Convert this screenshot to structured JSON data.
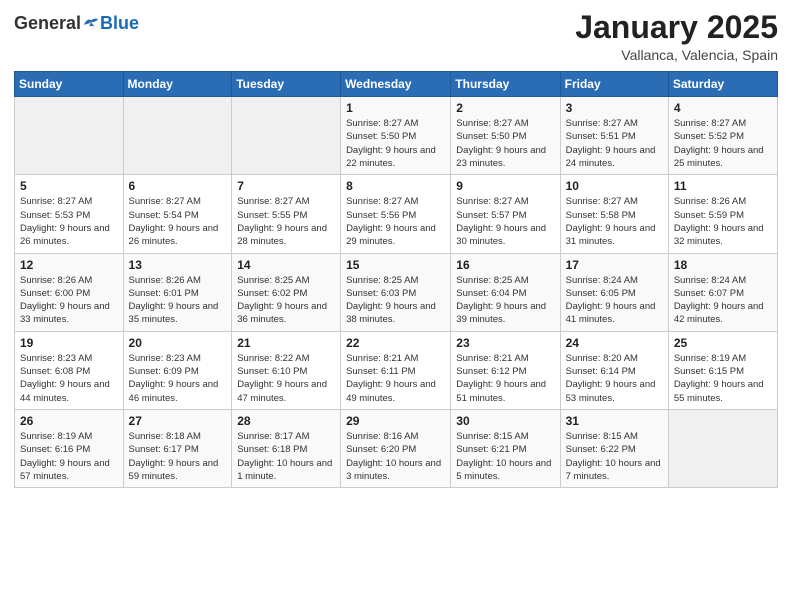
{
  "header": {
    "logo_general": "General",
    "logo_blue": "Blue",
    "month_title": "January 2025",
    "location": "Vallanca, Valencia, Spain"
  },
  "weekdays": [
    "Sunday",
    "Monday",
    "Tuesday",
    "Wednesday",
    "Thursday",
    "Friday",
    "Saturday"
  ],
  "weeks": [
    [
      {
        "day": "",
        "sunrise": "",
        "sunset": "",
        "daylight": ""
      },
      {
        "day": "",
        "sunrise": "",
        "sunset": "",
        "daylight": ""
      },
      {
        "day": "",
        "sunrise": "",
        "sunset": "",
        "daylight": ""
      },
      {
        "day": "1",
        "sunrise": "Sunrise: 8:27 AM",
        "sunset": "Sunset: 5:50 PM",
        "daylight": "Daylight: 9 hours and 22 minutes."
      },
      {
        "day": "2",
        "sunrise": "Sunrise: 8:27 AM",
        "sunset": "Sunset: 5:50 PM",
        "daylight": "Daylight: 9 hours and 23 minutes."
      },
      {
        "day": "3",
        "sunrise": "Sunrise: 8:27 AM",
        "sunset": "Sunset: 5:51 PM",
        "daylight": "Daylight: 9 hours and 24 minutes."
      },
      {
        "day": "4",
        "sunrise": "Sunrise: 8:27 AM",
        "sunset": "Sunset: 5:52 PM",
        "daylight": "Daylight: 9 hours and 25 minutes."
      }
    ],
    [
      {
        "day": "5",
        "sunrise": "Sunrise: 8:27 AM",
        "sunset": "Sunset: 5:53 PM",
        "daylight": "Daylight: 9 hours and 26 minutes."
      },
      {
        "day": "6",
        "sunrise": "Sunrise: 8:27 AM",
        "sunset": "Sunset: 5:54 PM",
        "daylight": "Daylight: 9 hours and 26 minutes."
      },
      {
        "day": "7",
        "sunrise": "Sunrise: 8:27 AM",
        "sunset": "Sunset: 5:55 PM",
        "daylight": "Daylight: 9 hours and 28 minutes."
      },
      {
        "day": "8",
        "sunrise": "Sunrise: 8:27 AM",
        "sunset": "Sunset: 5:56 PM",
        "daylight": "Daylight: 9 hours and 29 minutes."
      },
      {
        "day": "9",
        "sunrise": "Sunrise: 8:27 AM",
        "sunset": "Sunset: 5:57 PM",
        "daylight": "Daylight: 9 hours and 30 minutes."
      },
      {
        "day": "10",
        "sunrise": "Sunrise: 8:27 AM",
        "sunset": "Sunset: 5:58 PM",
        "daylight": "Daylight: 9 hours and 31 minutes."
      },
      {
        "day": "11",
        "sunrise": "Sunrise: 8:26 AM",
        "sunset": "Sunset: 5:59 PM",
        "daylight": "Daylight: 9 hours and 32 minutes."
      }
    ],
    [
      {
        "day": "12",
        "sunrise": "Sunrise: 8:26 AM",
        "sunset": "Sunset: 6:00 PM",
        "daylight": "Daylight: 9 hours and 33 minutes."
      },
      {
        "day": "13",
        "sunrise": "Sunrise: 8:26 AM",
        "sunset": "Sunset: 6:01 PM",
        "daylight": "Daylight: 9 hours and 35 minutes."
      },
      {
        "day": "14",
        "sunrise": "Sunrise: 8:25 AM",
        "sunset": "Sunset: 6:02 PM",
        "daylight": "Daylight: 9 hours and 36 minutes."
      },
      {
        "day": "15",
        "sunrise": "Sunrise: 8:25 AM",
        "sunset": "Sunset: 6:03 PM",
        "daylight": "Daylight: 9 hours and 38 minutes."
      },
      {
        "day": "16",
        "sunrise": "Sunrise: 8:25 AM",
        "sunset": "Sunset: 6:04 PM",
        "daylight": "Daylight: 9 hours and 39 minutes."
      },
      {
        "day": "17",
        "sunrise": "Sunrise: 8:24 AM",
        "sunset": "Sunset: 6:05 PM",
        "daylight": "Daylight: 9 hours and 41 minutes."
      },
      {
        "day": "18",
        "sunrise": "Sunrise: 8:24 AM",
        "sunset": "Sunset: 6:07 PM",
        "daylight": "Daylight: 9 hours and 42 minutes."
      }
    ],
    [
      {
        "day": "19",
        "sunrise": "Sunrise: 8:23 AM",
        "sunset": "Sunset: 6:08 PM",
        "daylight": "Daylight: 9 hours and 44 minutes."
      },
      {
        "day": "20",
        "sunrise": "Sunrise: 8:23 AM",
        "sunset": "Sunset: 6:09 PM",
        "daylight": "Daylight: 9 hours and 46 minutes."
      },
      {
        "day": "21",
        "sunrise": "Sunrise: 8:22 AM",
        "sunset": "Sunset: 6:10 PM",
        "daylight": "Daylight: 9 hours and 47 minutes."
      },
      {
        "day": "22",
        "sunrise": "Sunrise: 8:21 AM",
        "sunset": "Sunset: 6:11 PM",
        "daylight": "Daylight: 9 hours and 49 minutes."
      },
      {
        "day": "23",
        "sunrise": "Sunrise: 8:21 AM",
        "sunset": "Sunset: 6:12 PM",
        "daylight": "Daylight: 9 hours and 51 minutes."
      },
      {
        "day": "24",
        "sunrise": "Sunrise: 8:20 AM",
        "sunset": "Sunset: 6:14 PM",
        "daylight": "Daylight: 9 hours and 53 minutes."
      },
      {
        "day": "25",
        "sunrise": "Sunrise: 8:19 AM",
        "sunset": "Sunset: 6:15 PM",
        "daylight": "Daylight: 9 hours and 55 minutes."
      }
    ],
    [
      {
        "day": "26",
        "sunrise": "Sunrise: 8:19 AM",
        "sunset": "Sunset: 6:16 PM",
        "daylight": "Daylight: 9 hours and 57 minutes."
      },
      {
        "day": "27",
        "sunrise": "Sunrise: 8:18 AM",
        "sunset": "Sunset: 6:17 PM",
        "daylight": "Daylight: 9 hours and 59 minutes."
      },
      {
        "day": "28",
        "sunrise": "Sunrise: 8:17 AM",
        "sunset": "Sunset: 6:18 PM",
        "daylight": "Daylight: 10 hours and 1 minute."
      },
      {
        "day": "29",
        "sunrise": "Sunrise: 8:16 AM",
        "sunset": "Sunset: 6:20 PM",
        "daylight": "Daylight: 10 hours and 3 minutes."
      },
      {
        "day": "30",
        "sunrise": "Sunrise: 8:15 AM",
        "sunset": "Sunset: 6:21 PM",
        "daylight": "Daylight: 10 hours and 5 minutes."
      },
      {
        "day": "31",
        "sunrise": "Sunrise: 8:15 AM",
        "sunset": "Sunset: 6:22 PM",
        "daylight": "Daylight: 10 hours and 7 minutes."
      },
      {
        "day": "",
        "sunrise": "",
        "sunset": "",
        "daylight": ""
      }
    ]
  ]
}
